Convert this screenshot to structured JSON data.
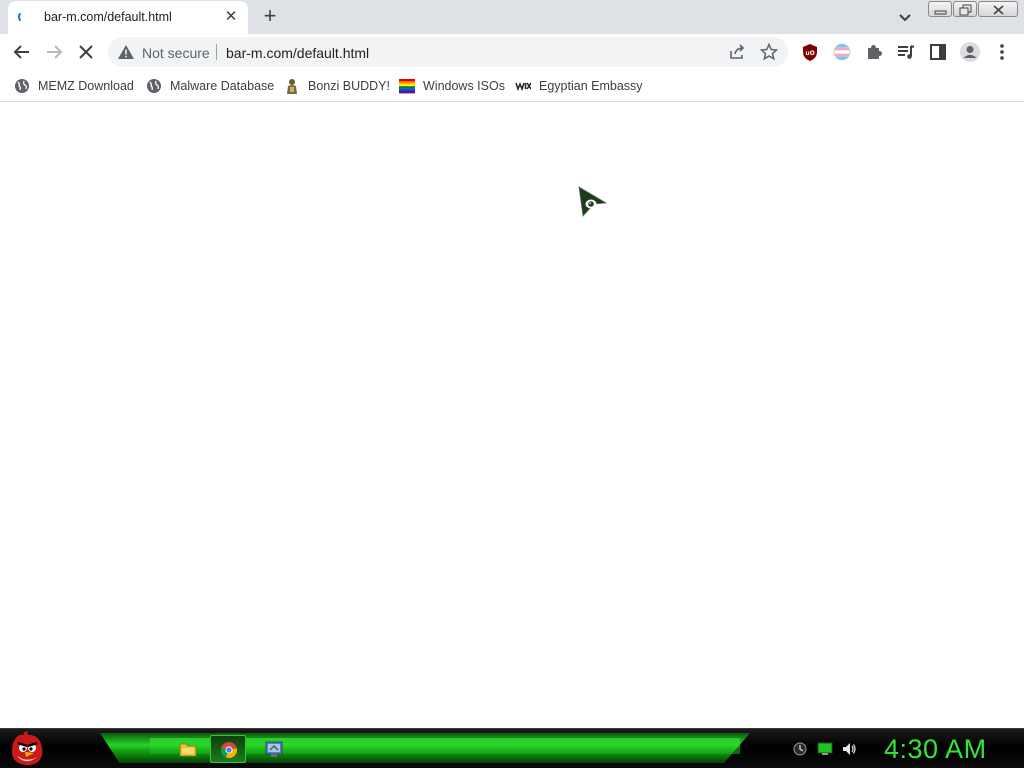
{
  "tab": {
    "title": "bar-m.com/default.html",
    "close_glyph": "✕"
  },
  "newtab": {
    "glyph": "+"
  },
  "omnibox": {
    "security_label": "Not secure",
    "url": "bar-m.com/default.html"
  },
  "bookmarks": [
    {
      "label": "MEMZ Download",
      "icon": "globe-icon"
    },
    {
      "label": "Malware Database",
      "icon": "globe-icon"
    },
    {
      "label": "Bonzi BUDDY!",
      "icon": "bonzi-icon"
    },
    {
      "label": "Windows ISOs",
      "icon": "rainbow-flag-icon"
    },
    {
      "label": "Egyptian Embassy",
      "icon": "wix-icon"
    }
  ],
  "taskbar": {
    "clock": "4:30 AM",
    "items": [
      "file-explorer-icon",
      "chrome-icon",
      "control-panel-icon"
    ],
    "tray": [
      "network-icon",
      "monitor-icon",
      "volume-icon"
    ]
  },
  "colors": {
    "tabstrip": "#dee1e6",
    "omnibox": "#f1f3f4",
    "taskbar_green": "#27d327",
    "clock": "#36e436"
  }
}
